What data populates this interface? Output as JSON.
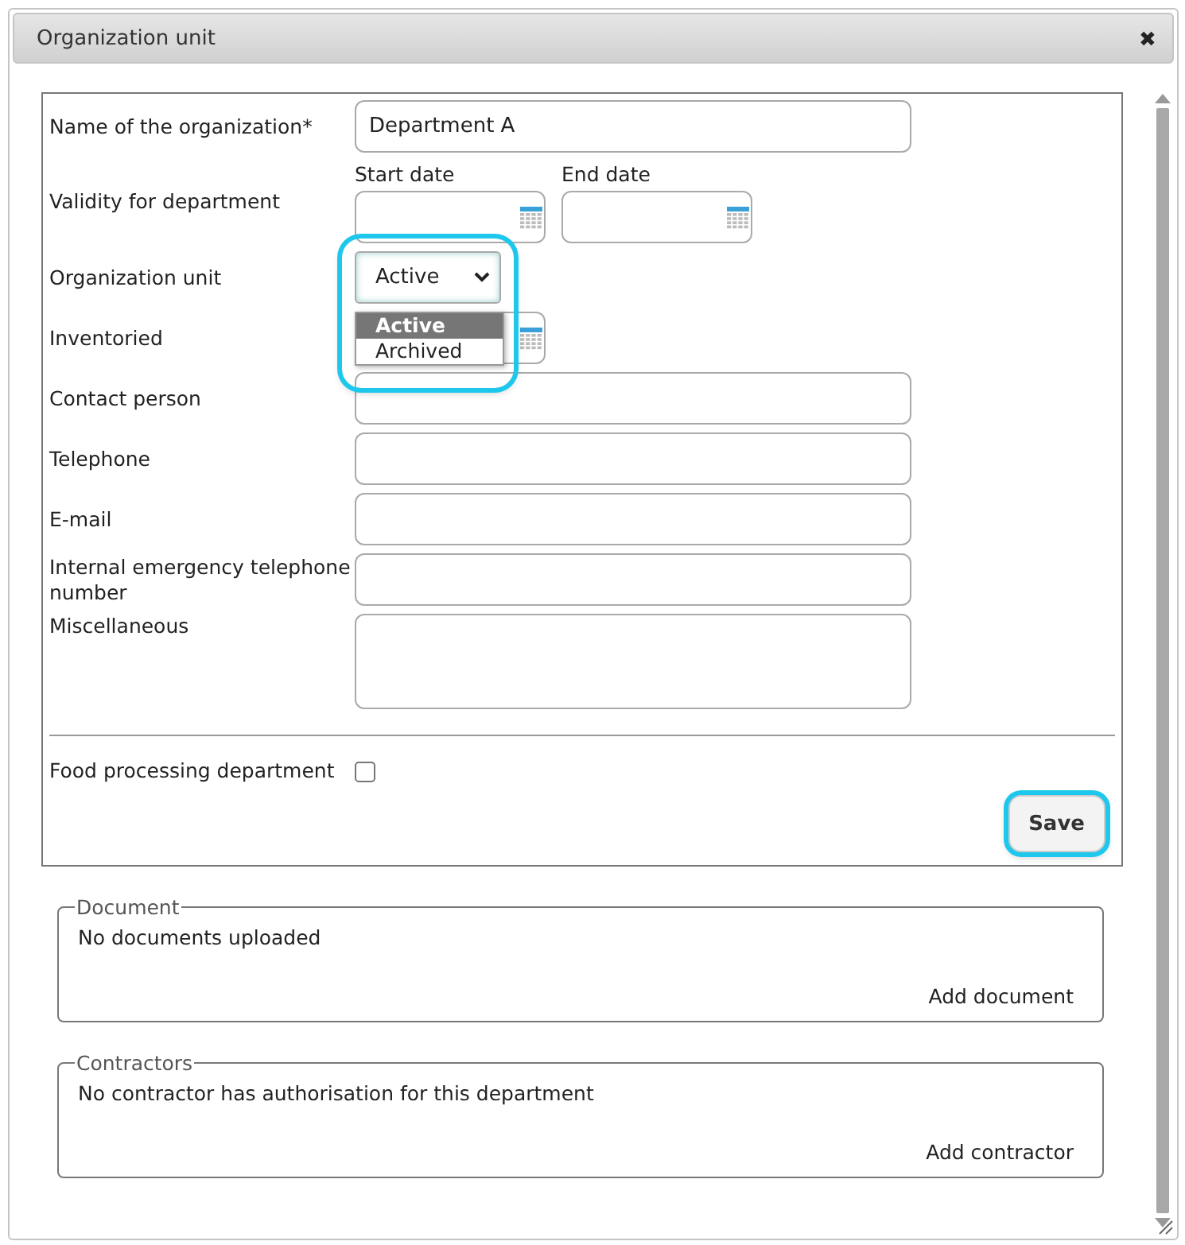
{
  "window": {
    "title": "Organization unit",
    "close": "✖"
  },
  "form": {
    "rows": [
      {
        "kind": "text",
        "label": "Name of the organization*",
        "value": "Department A"
      },
      {
        "kind": "daterange",
        "label": "Validity for department",
        "start_label": "Start date",
        "end_label": "End date"
      },
      {
        "kind": "select",
        "label": "Organization unit",
        "value": "Active",
        "expanded": true,
        "highlighted": true,
        "options": [
          {
            "label": "Active",
            "selected": true
          },
          {
            "label": "Archived",
            "selected": false
          }
        ]
      },
      {
        "kind": "date",
        "label": "Inventoried"
      },
      {
        "kind": "text",
        "label": "Contact person"
      },
      {
        "kind": "text",
        "label": "Telephone"
      },
      {
        "kind": "text",
        "label": "E-mail"
      },
      {
        "kind": "text",
        "label": "Internal emergency telephone number"
      },
      {
        "kind": "textarea",
        "label": "Miscellaneous"
      }
    ],
    "checkbox": {
      "label": "Food processing department",
      "checked": false
    },
    "save": {
      "label": "Save",
      "highlighted": true
    }
  },
  "sections": [
    {
      "legend": "Document",
      "message": "No documents uploaded",
      "action": "Add document"
    },
    {
      "legend": "Contractors",
      "message": "No contractor has authorisation for this department",
      "action": "Add contractor"
    }
  ]
}
